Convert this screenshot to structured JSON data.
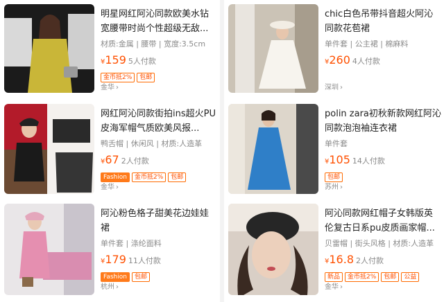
{
  "products": [
    {
      "title": "明星网红阿沁同款欧美水钻宽腰带时尚个性超级无敌...",
      "attrs": "材质:金属 | 腰带 | 宽度:3.5cm",
      "currency": "¥",
      "price": "159",
      "buyers": "5人付款",
      "tags": [
        "金币抵2%",
        "包邮"
      ],
      "location": "金华"
    },
    {
      "title": "chic白色吊带抖音超火阿沁同款花苞裙",
      "attrs": "单件套 | 公主裙 | 棉麻料",
      "currency": "¥",
      "price": "260",
      "buyers": "4人付款",
      "tags": [],
      "location": "深圳"
    },
    {
      "title": "网红阿沁同款街拍ins超火PU皮海军帽气质欧美风报...",
      "attrs": "鸭舌帽 | 休闲风 | 材质:人造革",
      "currency": "¥",
      "price": "67",
      "buyers": "2人付款",
      "tags": [
        "Fashion",
        "金币抵2%",
        "包邮"
      ],
      "location": "金华"
    },
    {
      "title": "polin zara初秋新款网红阿沁同款泡泡袖连衣裙",
      "attrs": "单件套",
      "currency": "¥",
      "price": "105",
      "buyers": "14人付款",
      "tags": [
        "包邮"
      ],
      "location": "苏州"
    },
    {
      "title": "阿沁粉色格子甜美花边娃娃裙",
      "attrs": "单件套 | 涤纶面料",
      "currency": "¥",
      "price": "179",
      "buyers": "11人付款",
      "tags": [
        "Fashion",
        "包邮"
      ],
      "location": "杭州"
    },
    {
      "title": "阿沁同款网红帽子女韩版英伦复古日系pu皮质画家帽...",
      "attrs": "贝雷帽 | 街头风格 | 材质:人造革",
      "currency": "¥",
      "price": "16.8",
      "buyers": "2人付款",
      "tags": [
        "新品",
        "金币抵2%",
        "包邮",
        "公益"
      ],
      "location": "金华"
    }
  ],
  "colors": {
    "price": "#ff5000",
    "tag_border": "#ff6a00",
    "muted": "#8a8a8a"
  }
}
